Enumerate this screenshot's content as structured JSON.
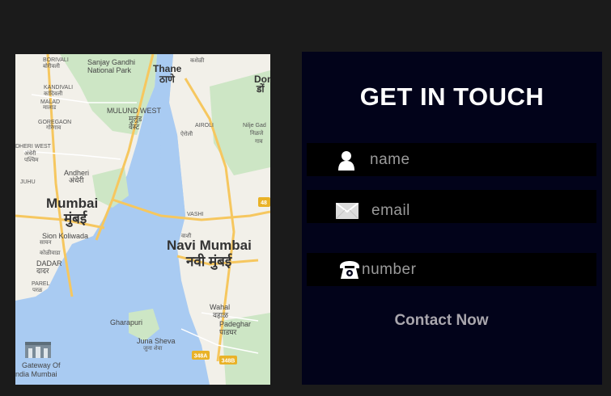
{
  "map": {
    "labels": {
      "borivali": "BORIVALI",
      "borivali_local": "बोरीवली",
      "sanjay": "Sanjay Gandhi",
      "sanjay2": "National Park",
      "thane": "Thane",
      "thane_local": "ठाणे",
      "kandivali": "KANDIVALI",
      "kandivali_local": "कांदिवली",
      "malad": "MALAD",
      "malad_local": "मालाड",
      "mulund": "MULUND WEST",
      "mulund_local": "मुलुंड",
      "mulund_local2": "वेस्ट",
      "goregaon": "GOREGAON",
      "goregaon_local": "गोरेगाव",
      "andheri_west": "DHERI WEST",
      "andheri_west_local": "अंधेरी",
      "andheri_west_local2": "पश्चिम",
      "andheri": "Andheri",
      "andheri_local": "अंधेरी",
      "juhu": "JUHU",
      "airoli": "AIROLI",
      "airoli_local": "ऐरोली",
      "dombivli": "Dom",
      "dombivli_local": "डों",
      "nilje": "Nilje Gad",
      "nilje_local": "निळजे",
      "nilje_local2": "गाव",
      "mumbai": "Mumbai",
      "mumbai_local": "मुंबई",
      "vashi": "VASHI",
      "vashi_local": "वाशी",
      "navi_mumbai": "Navi Mumbai",
      "navi_mumbai_local": "नवी मुंबई",
      "sion": "Sion Koliwada",
      "sion_local": "सायन",
      "sion_local2": "कोळीवाडा",
      "dadar": "DADAR",
      "dadar_local": "दादर",
      "parel": "PAREL",
      "parel_local": "परळ",
      "gharapuri": "Gharapuri",
      "wahal": "Wahal",
      "wahal_local": "वहाळ",
      "padeghar": "Padeghar",
      "padeghar_local": "पाडघर",
      "juna_sheva": "Juna Sheva",
      "juna_sheva_local": "जुना शेवा",
      "gateway": "Gateway Of",
      "gateway2": "ndia Mumbai",
      "shield_348a": "348A",
      "shield_348b": "348B",
      "shield_48": "48",
      "kashidi": "कशेळी"
    }
  },
  "contact": {
    "title": "GET IN TOUCH",
    "name_placeholder": "name",
    "email_placeholder": "email",
    "number_placeholder": "number",
    "button_label": "Contact Now"
  },
  "colors": {
    "page_bg": "#1b1b1b",
    "panel_bg": "#02031a",
    "field_bg": "#000000",
    "water": "#a9cbf2",
    "land": "#f2f0e9",
    "park": "#cde6c5",
    "road": "#f6c75f"
  }
}
